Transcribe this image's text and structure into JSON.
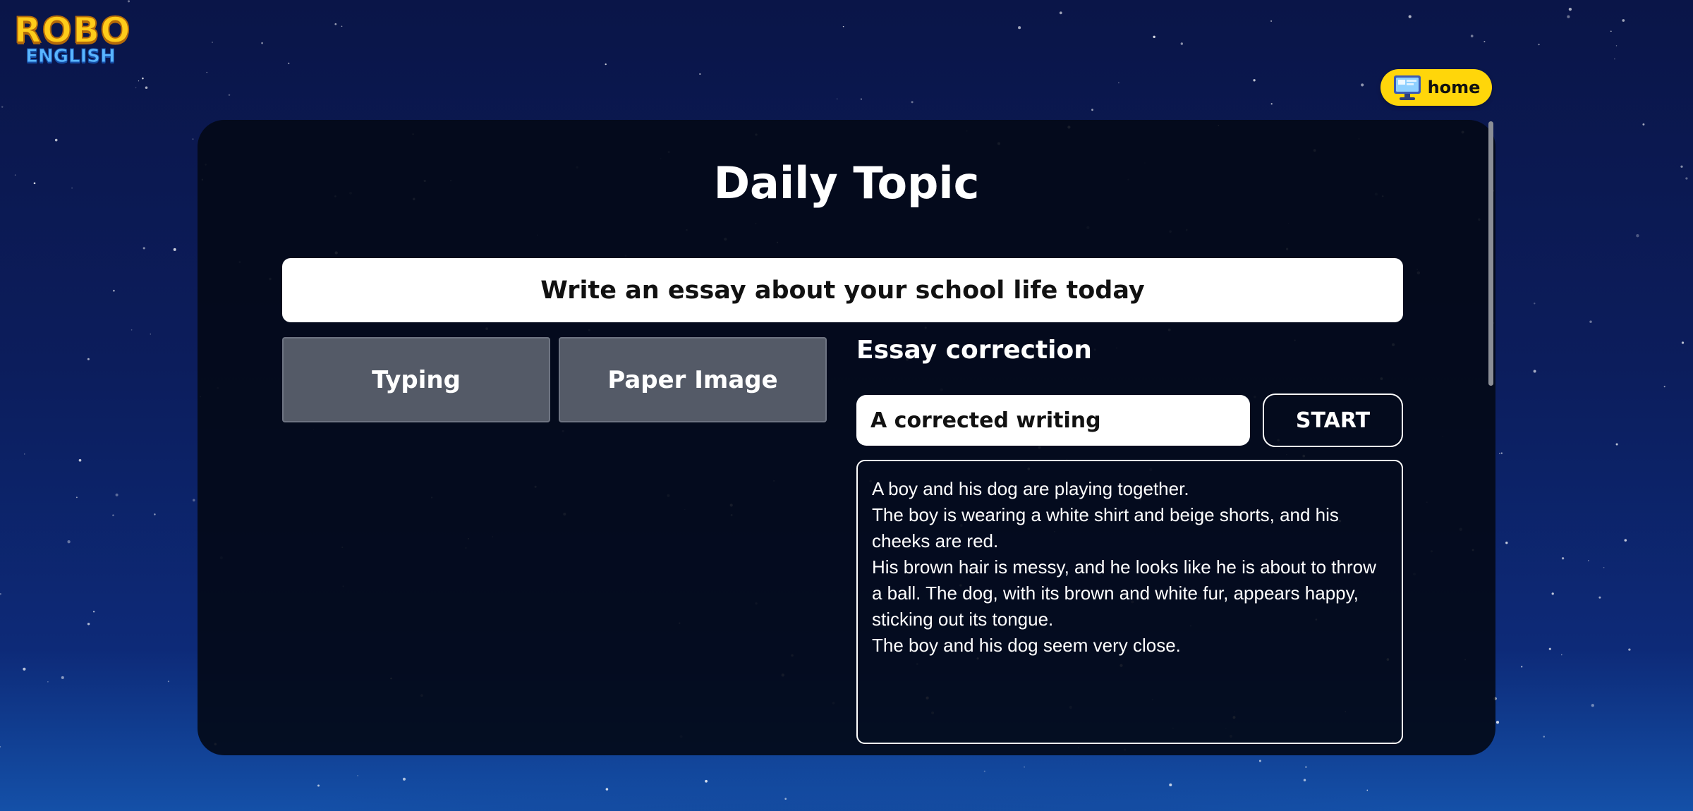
{
  "logo": {
    "line1": "ROBO",
    "line2": "ENGLISH"
  },
  "header": {
    "home_label": "home",
    "home_icon": "computer-monitor-icon"
  },
  "main": {
    "title": "Daily Topic",
    "topic": "Write an essay about your school life today",
    "modes": [
      "Typing",
      "Paper Image"
    ],
    "correction": {
      "heading": "Essay correction",
      "selected_option": "A corrected writing",
      "start_label": "START",
      "essay_lines": [
        "A boy and his dog are playing together.",
        "The boy is wearing a white shirt and beige shorts, and his cheeks are red.",
        "His brown hair is messy, and he looks like he is about to throw a ball. The dog, with its brown and white fur, appears happy, sticking out its tongue.",
        "The boy and his dog seem very close."
      ]
    }
  },
  "colors": {
    "accent": "#ffd60a",
    "logo_yellow": "#ffcc1a",
    "logo_blue": "#5ab6ff",
    "panel_bg": "#030916",
    "mode_button_bg": "#545a67",
    "background_top": "#0a1548",
    "background_bottom": "#1450a8"
  }
}
